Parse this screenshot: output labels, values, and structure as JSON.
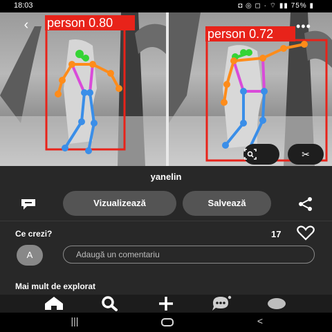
{
  "status_bar": {
    "time": "18:03",
    "battery": "75%"
  },
  "photo": {
    "left_detection": {
      "label": "person",
      "score": "0.80"
    },
    "right_detection": {
      "label": "person",
      "score": "0.72"
    }
  },
  "pin": {
    "username": "yanelin"
  },
  "actions": {
    "view_label": "Vizualizează",
    "save_label": "Salvează"
  },
  "comments": {
    "heading": "Ce crezi?",
    "like_count": "17",
    "avatar_letter": "A",
    "placeholder": "Adaugă un comentariu"
  },
  "explore": {
    "heading": "Mai mult de explorat"
  },
  "colors": {
    "detection_box": "#e8231a",
    "sheet_bg": "#282828",
    "pill_bg": "#545454"
  },
  "icons": [
    "back-icon",
    "more-icon",
    "visual-search-icon",
    "scissors-icon",
    "comment-bubble-icon",
    "share-icon",
    "heart-icon",
    "home-icon",
    "search-icon",
    "create-icon",
    "messages-icon",
    "profile-icon"
  ]
}
